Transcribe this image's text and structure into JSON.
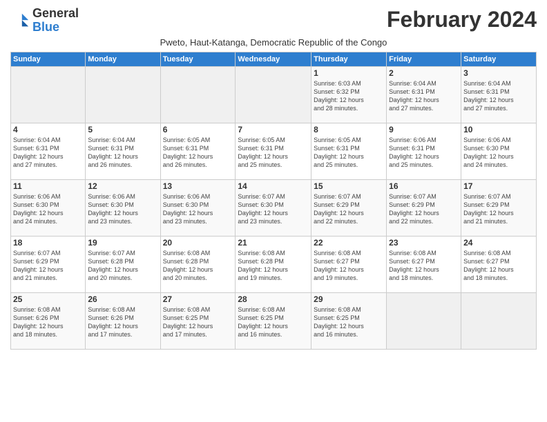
{
  "header": {
    "logo_line1": "General",
    "logo_line2": "Blue",
    "month_title": "February 2024",
    "subtitle": "Pweto, Haut-Katanga, Democratic Republic of the Congo"
  },
  "days_of_week": [
    "Sunday",
    "Monday",
    "Tuesday",
    "Wednesday",
    "Thursday",
    "Friday",
    "Saturday"
  ],
  "weeks": [
    [
      {
        "day": "",
        "info": ""
      },
      {
        "day": "",
        "info": ""
      },
      {
        "day": "",
        "info": ""
      },
      {
        "day": "",
        "info": ""
      },
      {
        "day": "1",
        "info": "Sunrise: 6:03 AM\nSunset: 6:32 PM\nDaylight: 12 hours\nand 28 minutes."
      },
      {
        "day": "2",
        "info": "Sunrise: 6:04 AM\nSunset: 6:31 PM\nDaylight: 12 hours\nand 27 minutes."
      },
      {
        "day": "3",
        "info": "Sunrise: 6:04 AM\nSunset: 6:31 PM\nDaylight: 12 hours\nand 27 minutes."
      }
    ],
    [
      {
        "day": "4",
        "info": "Sunrise: 6:04 AM\nSunset: 6:31 PM\nDaylight: 12 hours\nand 27 minutes."
      },
      {
        "day": "5",
        "info": "Sunrise: 6:04 AM\nSunset: 6:31 PM\nDaylight: 12 hours\nand 26 minutes."
      },
      {
        "day": "6",
        "info": "Sunrise: 6:05 AM\nSunset: 6:31 PM\nDaylight: 12 hours\nand 26 minutes."
      },
      {
        "day": "7",
        "info": "Sunrise: 6:05 AM\nSunset: 6:31 PM\nDaylight: 12 hours\nand 25 minutes."
      },
      {
        "day": "8",
        "info": "Sunrise: 6:05 AM\nSunset: 6:31 PM\nDaylight: 12 hours\nand 25 minutes."
      },
      {
        "day": "9",
        "info": "Sunrise: 6:06 AM\nSunset: 6:31 PM\nDaylight: 12 hours\nand 25 minutes."
      },
      {
        "day": "10",
        "info": "Sunrise: 6:06 AM\nSunset: 6:30 PM\nDaylight: 12 hours\nand 24 minutes."
      }
    ],
    [
      {
        "day": "11",
        "info": "Sunrise: 6:06 AM\nSunset: 6:30 PM\nDaylight: 12 hours\nand 24 minutes."
      },
      {
        "day": "12",
        "info": "Sunrise: 6:06 AM\nSunset: 6:30 PM\nDaylight: 12 hours\nand 23 minutes."
      },
      {
        "day": "13",
        "info": "Sunrise: 6:06 AM\nSunset: 6:30 PM\nDaylight: 12 hours\nand 23 minutes."
      },
      {
        "day": "14",
        "info": "Sunrise: 6:07 AM\nSunset: 6:30 PM\nDaylight: 12 hours\nand 23 minutes."
      },
      {
        "day": "15",
        "info": "Sunrise: 6:07 AM\nSunset: 6:29 PM\nDaylight: 12 hours\nand 22 minutes."
      },
      {
        "day": "16",
        "info": "Sunrise: 6:07 AM\nSunset: 6:29 PM\nDaylight: 12 hours\nand 22 minutes."
      },
      {
        "day": "17",
        "info": "Sunrise: 6:07 AM\nSunset: 6:29 PM\nDaylight: 12 hours\nand 21 minutes."
      }
    ],
    [
      {
        "day": "18",
        "info": "Sunrise: 6:07 AM\nSunset: 6:29 PM\nDaylight: 12 hours\nand 21 minutes."
      },
      {
        "day": "19",
        "info": "Sunrise: 6:07 AM\nSunset: 6:28 PM\nDaylight: 12 hours\nand 20 minutes."
      },
      {
        "day": "20",
        "info": "Sunrise: 6:08 AM\nSunset: 6:28 PM\nDaylight: 12 hours\nand 20 minutes."
      },
      {
        "day": "21",
        "info": "Sunrise: 6:08 AM\nSunset: 6:28 PM\nDaylight: 12 hours\nand 19 minutes."
      },
      {
        "day": "22",
        "info": "Sunrise: 6:08 AM\nSunset: 6:27 PM\nDaylight: 12 hours\nand 19 minutes."
      },
      {
        "day": "23",
        "info": "Sunrise: 6:08 AM\nSunset: 6:27 PM\nDaylight: 12 hours\nand 18 minutes."
      },
      {
        "day": "24",
        "info": "Sunrise: 6:08 AM\nSunset: 6:27 PM\nDaylight: 12 hours\nand 18 minutes."
      }
    ],
    [
      {
        "day": "25",
        "info": "Sunrise: 6:08 AM\nSunset: 6:26 PM\nDaylight: 12 hours\nand 18 minutes."
      },
      {
        "day": "26",
        "info": "Sunrise: 6:08 AM\nSunset: 6:26 PM\nDaylight: 12 hours\nand 17 minutes."
      },
      {
        "day": "27",
        "info": "Sunrise: 6:08 AM\nSunset: 6:25 PM\nDaylight: 12 hours\nand 17 minutes."
      },
      {
        "day": "28",
        "info": "Sunrise: 6:08 AM\nSunset: 6:25 PM\nDaylight: 12 hours\nand 16 minutes."
      },
      {
        "day": "29",
        "info": "Sunrise: 6:08 AM\nSunset: 6:25 PM\nDaylight: 12 hours\nand 16 minutes."
      },
      {
        "day": "",
        "info": ""
      },
      {
        "day": "",
        "info": ""
      }
    ]
  ]
}
